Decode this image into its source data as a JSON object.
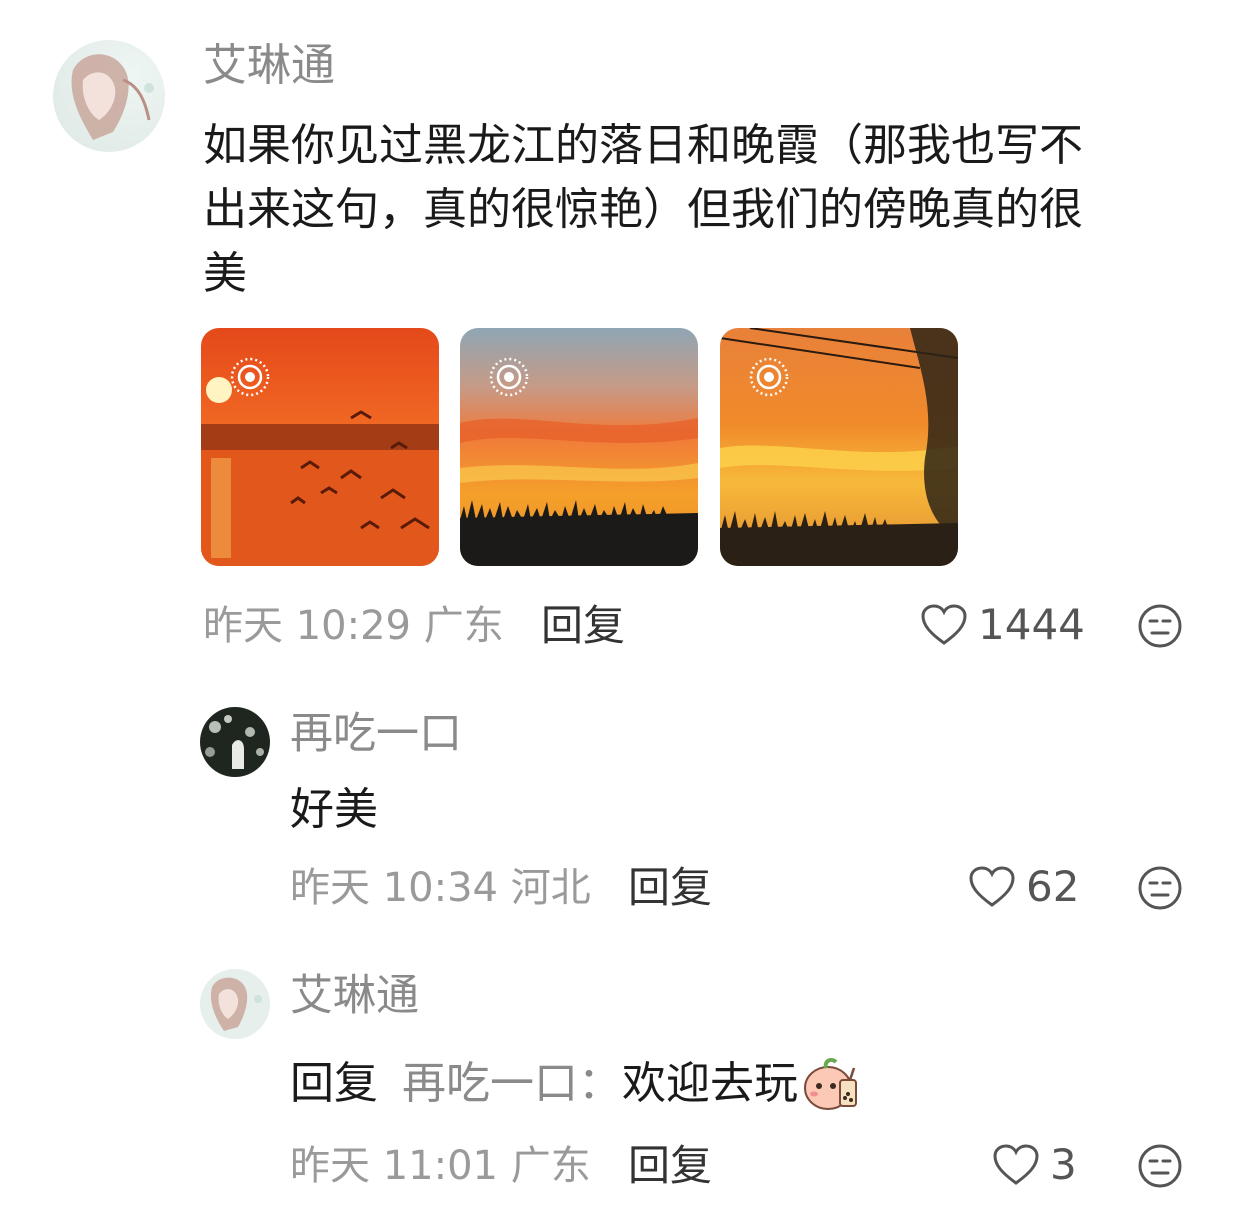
{
  "comments": [
    {
      "username": "艾琳通",
      "text_line1": "如果你见过黑龙江的落日和晚霞（那我也写不",
      "text_line2": "出来这句，真的很惊艳）但我们的傍晚真的很",
      "text_line3": "美",
      "images": [
        {
          "name": "sunset-river-birds"
        },
        {
          "name": "sunset-sky-grass"
        },
        {
          "name": "sunset-willow"
        }
      ],
      "meta": "昨天 10:29 广东",
      "reply_label": "回复",
      "likes": "1444"
    },
    {
      "username": "再吃一口",
      "text": "好美",
      "meta": "昨天 10:34 河北",
      "reply_label": "回复",
      "likes": "62"
    },
    {
      "username": "艾琳通",
      "reply_prefix": "回复",
      "reply_to": "再吃一口：",
      "text": "欢迎去玩",
      "meta": "昨天 11:01 广东",
      "reply_label": "回复",
      "likes": "3"
    }
  ],
  "colors": {
    "username": "#8a8a8a",
    "text": "#1a1a1a",
    "meta": "#9a9a9a",
    "icon": "#555555"
  }
}
